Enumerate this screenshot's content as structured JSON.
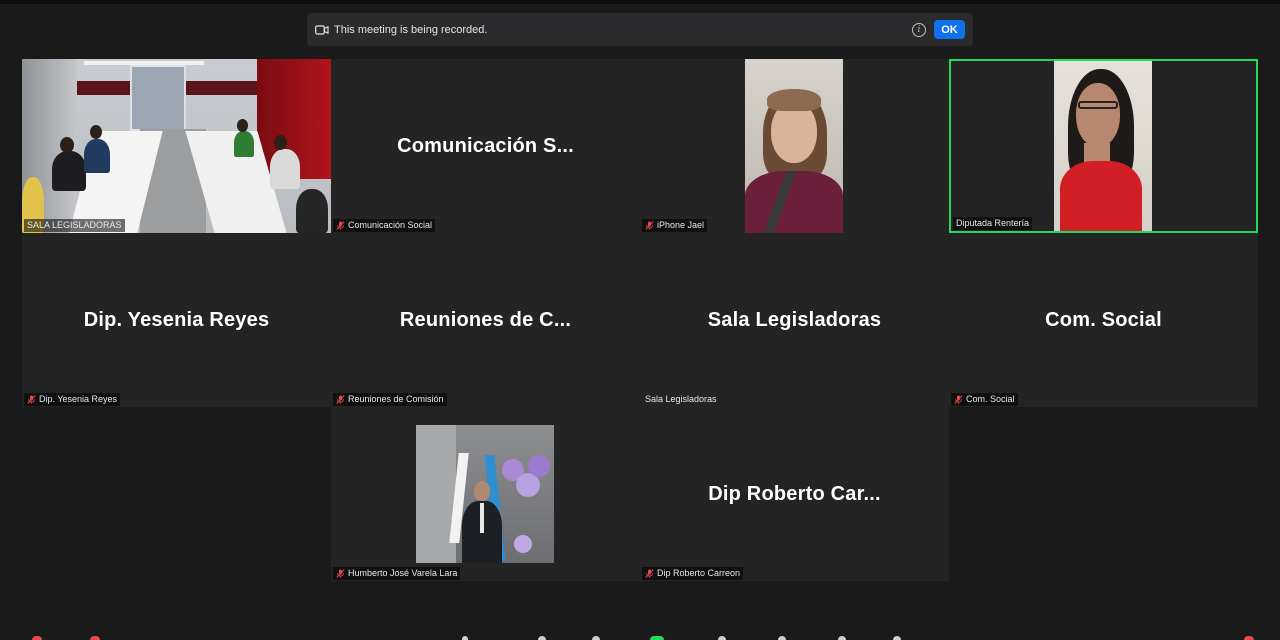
{
  "banner": {
    "message": "This meeting is being recorded.",
    "ok_label": "OK"
  },
  "tiles": [
    {
      "label": "SALA LEGISLADORAS",
      "display_name": "",
      "muted": false,
      "video": true
    },
    {
      "label": "Comunicación Social",
      "display_name": "Comunicación S...",
      "muted": true,
      "video": false
    },
    {
      "label": "iPhone Jael",
      "display_name": "",
      "muted": true,
      "video": true
    },
    {
      "label": "Diputada Rentería",
      "display_name": "",
      "muted": false,
      "video": true,
      "active_speaker": true
    },
    {
      "label": "Dip. Yesenia Reyes",
      "display_name": "Dip. Yesenia Reyes",
      "muted": true,
      "video": false
    },
    {
      "label": "Reuniones de Comisión",
      "display_name": "Reuniones de C...",
      "muted": true,
      "video": false
    },
    {
      "label": "Sala Legisladoras",
      "display_name": "Sala Legisladoras",
      "muted": false,
      "video": false
    },
    {
      "label": "Com. Social",
      "display_name": "Com. Social",
      "muted": true,
      "video": false
    },
    {
      "label": "Humberto José Varela Lara",
      "display_name": "",
      "muted": true,
      "video": true
    },
    {
      "label": "Dip Roberto Carreon",
      "display_name": "Dip Roberto Car...",
      "muted": true,
      "video": false
    }
  ],
  "colors": {
    "active_speaker_border": "#23d959",
    "ok_button": "#0e72ed",
    "muted_icon": "#e5484d"
  },
  "icons": {
    "banner": "recording-icon",
    "info": "info-icon",
    "muted": "mic-off-icon"
  }
}
